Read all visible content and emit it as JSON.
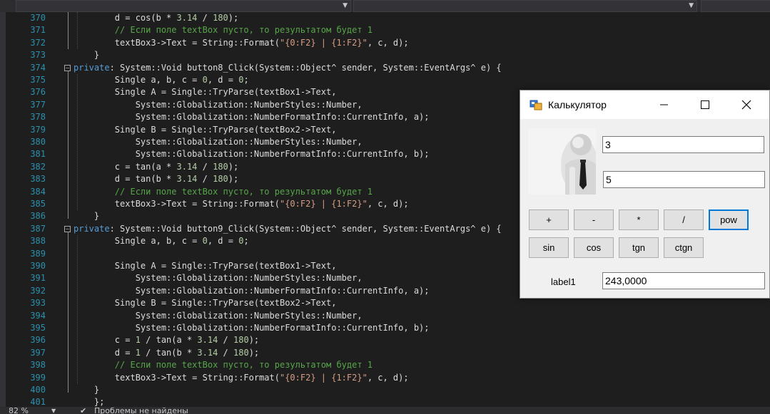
{
  "editor": {
    "lines": [
      {
        "n": "370",
        "html": "        d = cos(b * <span class='nm'>3.14</span> / <span class='nm'>180</span>);"
      },
      {
        "n": "371",
        "html": "        <span class='cm'>// Если поле textBox пусто, то результатом будет 1</span>"
      },
      {
        "n": "372",
        "html": "        textBox3->Text = String::Format(<span class='st'>\"{0:F2} | {1:F2}\"</span>, c, d);"
      },
      {
        "n": "373",
        "html": "    }"
      },
      {
        "n": "374",
        "html": "<span class='kw'>private</span>: System::Void button8_Click(System::Object^ sender, System::EventArgs^ e) {"
      },
      {
        "n": "375",
        "html": "        Single a, b, c = <span class='nm'>0</span>, d = <span class='nm'>0</span>;"
      },
      {
        "n": "376",
        "html": "        Single A = Single::TryParse(textBox1->Text,"
      },
      {
        "n": "377",
        "html": "            System::Globalization::NumberStyles::Number,"
      },
      {
        "n": "378",
        "html": "            System::Globalization::NumberFormatInfo::CurrentInfo, a);"
      },
      {
        "n": "379",
        "html": "        Single B = Single::TryParse(textBox2->Text,"
      },
      {
        "n": "380",
        "html": "            System::Globalization::NumberStyles::Number,"
      },
      {
        "n": "381",
        "html": "            System::Globalization::NumberFormatInfo::CurrentInfo, b);"
      },
      {
        "n": "382",
        "html": "        c = tan(a * <span class='nm'>3.14</span> / <span class='nm'>180</span>);"
      },
      {
        "n": "383",
        "html": "        d = tan(b * <span class='nm'>3.14</span> / <span class='nm'>180</span>);"
      },
      {
        "n": "384",
        "html": "        <span class='cm'>// Если поле textBox пусто, то результатом будет 1</span>"
      },
      {
        "n": "385",
        "html": "        textBox3->Text = String::Format(<span class='st'>\"{0:F2} | {1:F2}\"</span>, c, d);"
      },
      {
        "n": "386",
        "html": "    }"
      },
      {
        "n": "387",
        "html": "<span class='kw'>private</span>: System::Void button9_Click(System::Object^ sender, System::EventArgs^ e) {"
      },
      {
        "n": "388",
        "html": "        Single a, b, c = <span class='nm'>0</span>, d = <span class='nm'>0</span>;"
      },
      {
        "n": "389",
        "html": ""
      },
      {
        "n": "390",
        "html": "        Single A = Single::TryParse(textBox1->Text,"
      },
      {
        "n": "391",
        "html": "            System::Globalization::NumberStyles::Number,"
      },
      {
        "n": "392",
        "html": "            System::Globalization::NumberFormatInfo::CurrentInfo, a);"
      },
      {
        "n": "393",
        "html": "        Single B = Single::TryParse(textBox2->Text,"
      },
      {
        "n": "394",
        "html": "            System::Globalization::NumberStyles::Number,"
      },
      {
        "n": "395",
        "html": "            System::Globalization::NumberFormatInfo::CurrentInfo, b);"
      },
      {
        "n": "396",
        "html": "        c = <span class='nm'>1</span> / tan(a * <span class='nm'>3.14</span> / <span class='nm'>180</span>);"
      },
      {
        "n": "397",
        "html": "        d = <span class='nm'>1</span> / tan(b * <span class='nm'>3.14</span> / <span class='nm'>180</span>);"
      },
      {
        "n": "398",
        "html": "        <span class='cm'>// Если поле textBox пусто, то результатом будет 1</span>"
      },
      {
        "n": "399",
        "html": "        textBox3->Text = String::Format(<span class='st'>\"{0:F2} | {1:F2}\"</span>, c, d);"
      },
      {
        "n": "400",
        "html": "    }"
      },
      {
        "n": "401",
        "html": "    };"
      }
    ]
  },
  "status": {
    "zoom": "82 %",
    "issues": "Проблемы не найдены"
  },
  "calculator": {
    "title": "Калькулятор",
    "input1": "3",
    "input2": "5",
    "buttons_row1": [
      "+",
      "-",
      "*",
      "/",
      "pow"
    ],
    "buttons_row2": [
      "sin",
      "cos",
      "tgn",
      "ctgn"
    ],
    "label": "label1",
    "result": "243,0000"
  },
  "colors": {
    "accent": "#0078d7",
    "line_number": "#2b91af",
    "keyword": "#569cd6",
    "comment": "#57a64a",
    "string": "#d69d85"
  }
}
